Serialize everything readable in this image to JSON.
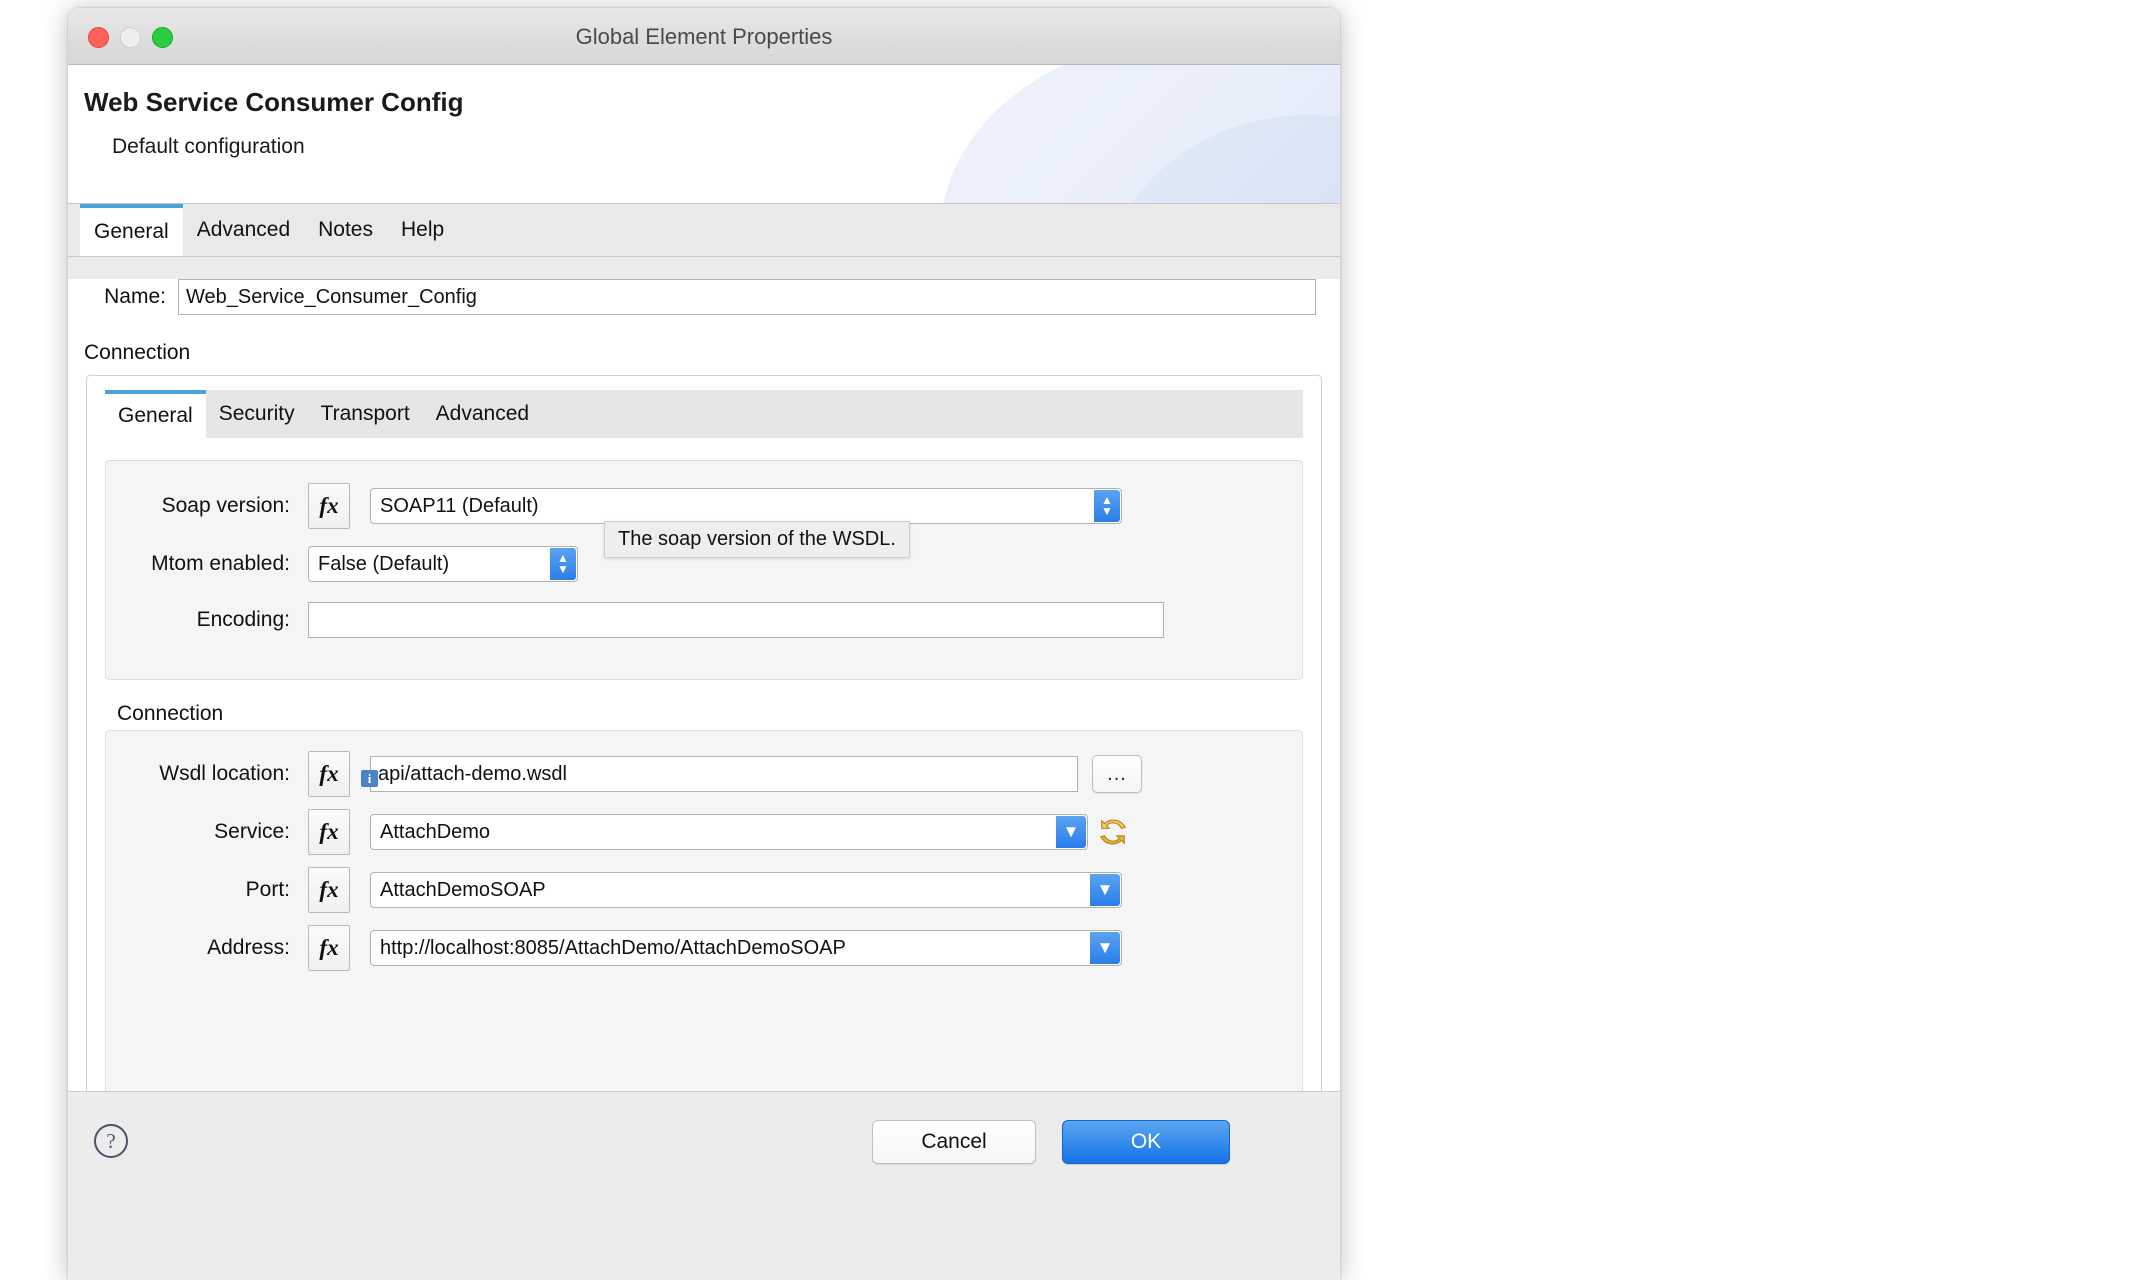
{
  "window": {
    "title": "Global Element Properties",
    "traffic_lights": [
      "close",
      "minimize",
      "maximize"
    ]
  },
  "header": {
    "title": "Web Service Consumer Config",
    "subtitle": "Default configuration"
  },
  "outer_tabs": [
    {
      "label": "General",
      "active": true
    },
    {
      "label": "Advanced",
      "active": false
    },
    {
      "label": "Notes",
      "active": false
    },
    {
      "label": "Help",
      "active": false
    }
  ],
  "name_field": {
    "label": "Name:",
    "value": "Web_Service_Consumer_Config",
    "placeholder": ""
  },
  "connection_section_label": "Connection",
  "inner_tabs": [
    {
      "label": "General",
      "active": true
    },
    {
      "label": "Security",
      "active": false
    },
    {
      "label": "Transport",
      "active": false
    },
    {
      "label": "Advanced",
      "active": false
    }
  ],
  "general_group": {
    "soap_version": {
      "label": "Soap version:",
      "value": "SOAP11 (Default)",
      "fx_label": "fx"
    },
    "mtom_enabled": {
      "label": "Mtom enabled:",
      "value": "False (Default)"
    },
    "encoding": {
      "label": "Encoding:",
      "value": "",
      "placeholder": ""
    }
  },
  "tooltip": {
    "text": "The soap version of the WSDL."
  },
  "connection_group": {
    "title": "Connection",
    "wsdl_location": {
      "label": "Wsdl location:",
      "value": "api/attach-demo.wsdl",
      "fx_label": "fx",
      "info_badge": "i",
      "browse_label": "..."
    },
    "service": {
      "label": "Service:",
      "value": "AttachDemo",
      "fx_label": "fx",
      "refresh_icon": "refresh-icon"
    },
    "port": {
      "label": "Port:",
      "value": "AttachDemoSOAP",
      "fx_label": "fx"
    },
    "address": {
      "label": "Address:",
      "value": "http://localhost:8085/AttachDemo/AttachDemoSOAP",
      "fx_label": "fx"
    }
  },
  "footer": {
    "help_icon": "help-icon",
    "cancel_label": "Cancel",
    "ok_label": "OK"
  },
  "colors": {
    "accent_blue": "#4ba3dc",
    "primary_button": "#1372e6",
    "badge_blue": "#4a84c4",
    "refresh_gold": "#e8b33c"
  }
}
